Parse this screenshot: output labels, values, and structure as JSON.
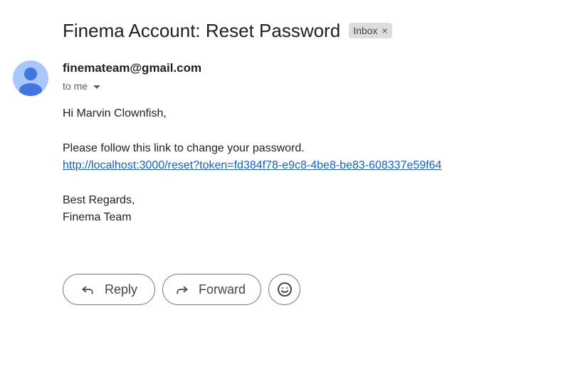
{
  "email": {
    "subject": "Finema Account: Reset Password",
    "label": "Inbox",
    "label_remove": "×",
    "sender": "finemateam@gmail.com",
    "recipients": "to me",
    "body": {
      "greeting": "Hi Marvin Clownfish,",
      "instruction": "Please follow this link to change your password.",
      "link": "http://localhost:3000/reset?token=fd384f78-e9c8-4be8-be83-608337e59f64",
      "closing": "Best Regards,",
      "signature": "Finema Team"
    }
  },
  "actions": {
    "reply_label": "Reply",
    "forward_label": "Forward"
  },
  "icons": {
    "avatar": "default-person-avatar",
    "reply": "reply-icon",
    "forward": "forward-icon",
    "emoji": "emoji-reaction-icon",
    "recipients_toggle": "caret-down-icon"
  },
  "colors": {
    "link": "#1a5fc4",
    "avatar_bg": "#a8c7fa",
    "avatar_fg": "#4374e0",
    "chip_bg": "#dddddd"
  }
}
